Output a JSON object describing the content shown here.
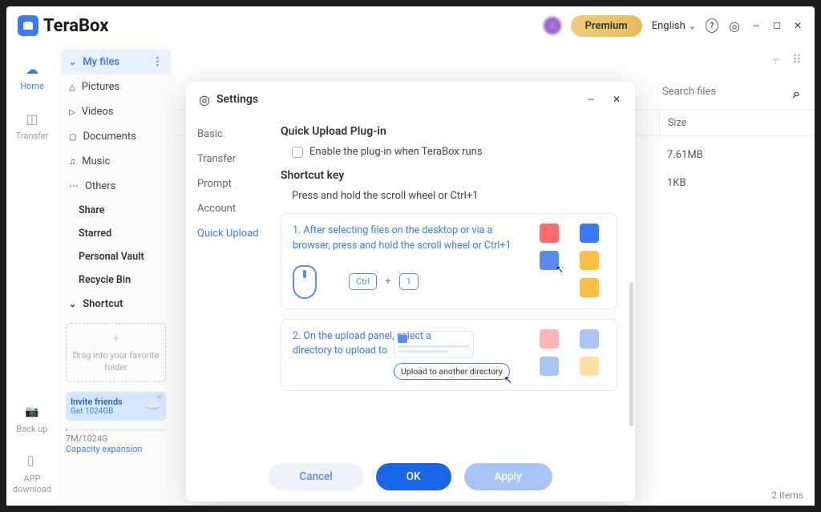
{
  "app": {
    "name": "TeraBox"
  },
  "titlebar": {
    "premium": "Premium",
    "language": "English"
  },
  "rail": {
    "home": "Home",
    "transfer": "Transfer",
    "backup": "Back up",
    "app_download": "APP download"
  },
  "folder_panel": {
    "my_files": "My files",
    "pictures": "Pictures",
    "videos": "Videos",
    "documents": "Documents",
    "music": "Music",
    "others": "Others",
    "share": "Share",
    "starred": "Starred",
    "personal_vault": "Personal Vault",
    "recycle_bin": "Recycle Bin",
    "shortcut": "Shortcut",
    "drag_hint": "Drag into your favorite folder",
    "invite_title": "Invite friends",
    "invite_sub": "Get 1024GB",
    "storage_used": "7M/1024G",
    "capacity_link": "Capacity expansion"
  },
  "main": {
    "search_placeholder": "Search files",
    "size_header": "Size",
    "rows": [
      {
        "size": "7.61MB"
      },
      {
        "size": "1KB"
      }
    ],
    "footer_count": "2 items"
  },
  "settings_modal": {
    "title": "Settings",
    "nav": {
      "basic": "Basic",
      "transfer": "Transfer",
      "prompt": "Prompt",
      "account": "Account",
      "quick_upload": "Quick Upload"
    },
    "content": {
      "heading1": "Quick Upload Plug-in",
      "checkbox_label": "Enable the plug-in when TeraBox runs",
      "heading2": "Shortcut key",
      "shortcut_desc": "Press and hold the scroll wheel or Ctrl+1",
      "step1": "1. After selecting files on the desktop or via a browser, press and hold the scroll wheel or Ctrl+1",
      "key_ctrl": "Ctrl",
      "key_plus": "+",
      "key_1": "1",
      "step2": "2. On the upload panel, select a directory to upload to",
      "upload_dir_badge": "Upload to another directory"
    },
    "footer": {
      "cancel": "Cancel",
      "ok": "OK",
      "apply": "Apply"
    }
  }
}
